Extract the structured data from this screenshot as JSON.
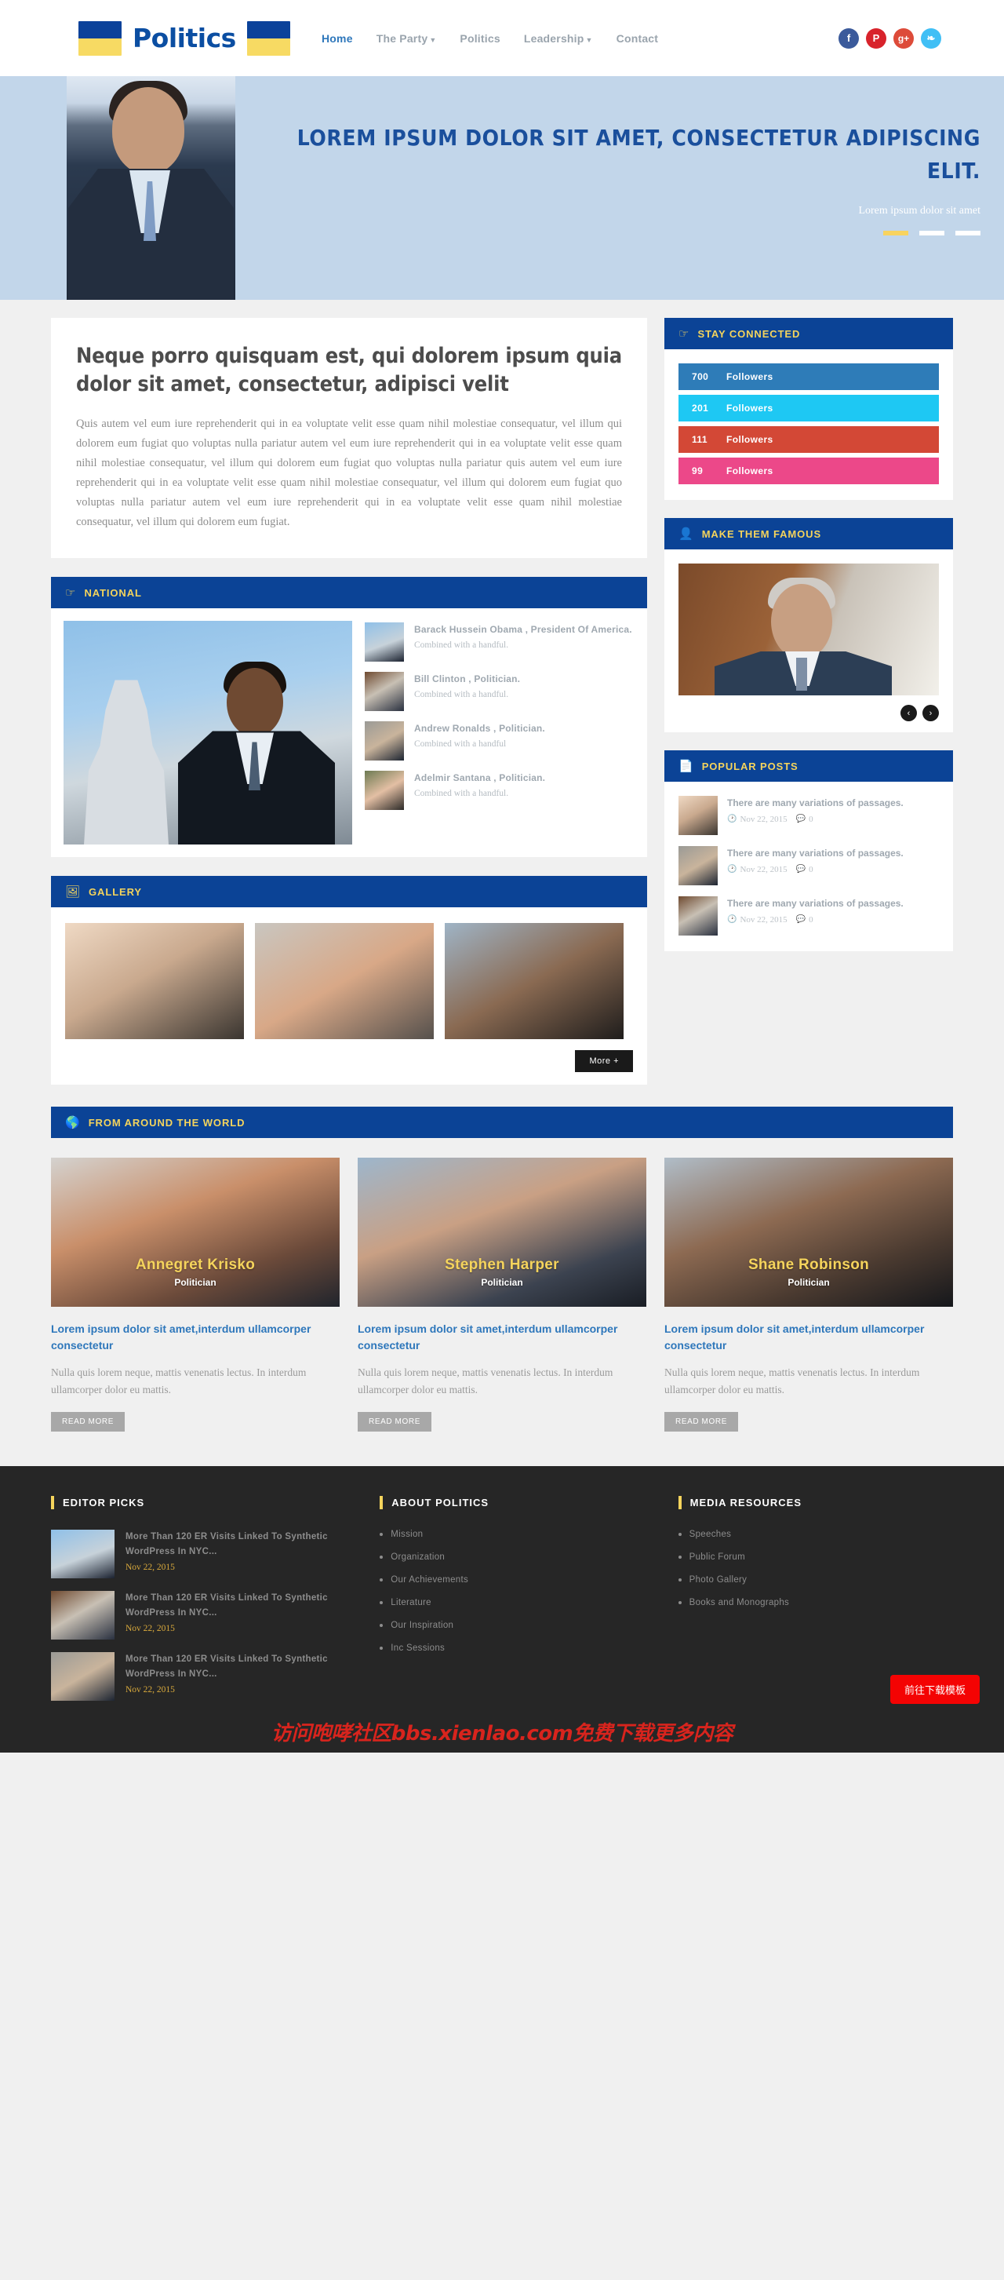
{
  "header": {
    "logo_text": "Politics",
    "nav": [
      {
        "label": "Home",
        "active": true,
        "caret": false
      },
      {
        "label": "The Party",
        "active": false,
        "caret": true
      },
      {
        "label": "Politics",
        "active": false,
        "caret": false
      },
      {
        "label": "Leadership",
        "active": false,
        "caret": true
      },
      {
        "label": "Contact",
        "active": false,
        "caret": false
      }
    ],
    "social": [
      {
        "name": "facebook",
        "glyph": "f"
      },
      {
        "name": "pinterest",
        "glyph": "P"
      },
      {
        "name": "googleplus",
        "glyph": "g+"
      },
      {
        "name": "twitter",
        "glyph": "❧"
      }
    ]
  },
  "hero": {
    "title": "LOREM IPSUM DOLOR SIT AMET, CONSECTETUR ADIPISCING ELIT.",
    "subtitle": "Lorem ipsum dolor sit amet",
    "slides": 3,
    "active_slide": 1
  },
  "intro": {
    "heading": "Neque porro quisquam est, qui dolorem ipsum quia dolor sit amet, consectetur, adipisci velit",
    "body": "Quis autem vel eum iure reprehenderit qui in ea voluptate velit esse quam nihil molestiae consequatur, vel illum qui dolorem eum fugiat quo voluptas nulla pariatur autem vel eum iure reprehenderit qui in ea voluptate velit esse quam nihil molestiae consequatur, vel illum qui dolorem eum fugiat quo voluptas nulla pariatur quis autem vel eum iure reprehenderit qui in ea voluptate velit esse quam nihil molestiae consequatur, vel illum qui dolorem eum fugiat quo voluptas nulla pariatur autem vel eum iure reprehenderit qui in ea voluptate velit esse quam nihil molestiae consequatur, vel illum qui dolorem eum fugiat."
  },
  "national": {
    "title": "NATIONAL",
    "icon": "pointing-hand-icon",
    "items": [
      {
        "name": "Barack Hussein Obama , President Of America.",
        "desc": "Combined with a handful."
      },
      {
        "name": "Bill Clinton , Politician.",
        "desc": "Combined with a handful."
      },
      {
        "name": "Andrew Ronalds , Politician.",
        "desc": "Combined with a handful"
      },
      {
        "name": "Adelmir Santana , Politician.",
        "desc": "Combined with a handful."
      }
    ]
  },
  "gallery": {
    "title": "GALLERY",
    "icon": "image-icon",
    "more_label": "More +",
    "items": [
      "gallery-photo-1",
      "gallery-photo-2",
      "gallery-photo-3"
    ]
  },
  "stay_connected": {
    "title": "STAY CONNECTED",
    "icon": "pointing-hand-icon",
    "rows": [
      {
        "count": "700",
        "label": "Followers",
        "color": "#2e7cb8"
      },
      {
        "count": "201",
        "label": "Followers",
        "color": "#1ec8f3"
      },
      {
        "count": "111",
        "label": "Followers",
        "color": "#d34836"
      },
      {
        "count": "99",
        "label": "Followers",
        "color": "#ec4889"
      }
    ]
  },
  "make_famous": {
    "title": "MAKE THEM FAMOUS",
    "icon": "user-icon",
    "prev_label": "‹",
    "next_label": "›"
  },
  "popular_posts": {
    "title": "POPULAR POSTS",
    "icon": "document-icon",
    "items": [
      {
        "title": "There are many variations of passages.",
        "date": "Nov 22, 2015",
        "comments": "0"
      },
      {
        "title": "There are many variations of passages.",
        "date": "Nov 22, 2015",
        "comments": "0"
      },
      {
        "title": "There are many variations of passages.",
        "date": "Nov 22, 2015",
        "comments": "0"
      }
    ]
  },
  "world": {
    "title": "FROM AROUND THE WORLD",
    "icon": "globe-icon",
    "cards": [
      {
        "name": "Annegret Krisko",
        "role": "Politician",
        "heading": "Lorem ipsum dolor sit amet,interdum ullamcorper consectetur",
        "body": "Nulla quis lorem neque, mattis venenatis lectus. In interdum ullamcorper dolor eu mattis.",
        "button": "READ MORE"
      },
      {
        "name": "Stephen Harper",
        "role": "Politician",
        "heading": "Lorem ipsum dolor sit amet,interdum ullamcorper consectetur",
        "body": "Nulla quis lorem neque, mattis venenatis lectus. In interdum ullamcorper dolor eu mattis.",
        "button": "READ MORE"
      },
      {
        "name": "Shane Robinson",
        "role": "Politician",
        "heading": "Lorem ipsum dolor sit amet,interdum ullamcorper consectetur",
        "body": "Nulla quis lorem neque, mattis venenatis lectus. In interdum ullamcorper dolor eu mattis.",
        "button": "READ MORE"
      }
    ]
  },
  "footer": {
    "editor_picks": {
      "title": "EDITOR PICKS",
      "items": [
        {
          "title": "More Than 120 ER Visits Linked To Synthetic WordPress In NYC...",
          "date": "Nov 22, 2015"
        },
        {
          "title": "More Than 120 ER Visits Linked To Synthetic WordPress In NYC...",
          "date": "Nov 22, 2015"
        },
        {
          "title": "More Than 120 ER Visits Linked To Synthetic WordPress In NYC...",
          "date": "Nov 22, 2015"
        }
      ]
    },
    "about": {
      "title": "ABOUT POLITICS",
      "links": [
        "Mission",
        "Organization",
        "Our Achievements",
        "Literature",
        "Our Inspiration",
        "Inc Sessions"
      ]
    },
    "media": {
      "title": "MEDIA RESOURCES",
      "links": [
        "Speeches",
        "Public Forum",
        "Photo Gallery",
        "Books and Monographs"
      ]
    }
  },
  "overlay": {
    "download_button": "前往下载模板",
    "watermark": "访问咆哮社区bbs.xienlao.com免费下载更多内容"
  },
  "colors": {
    "brand_blue": "#0b4396",
    "brand_yellow": "#f5d45c",
    "link_blue": "#2e77bb"
  }
}
